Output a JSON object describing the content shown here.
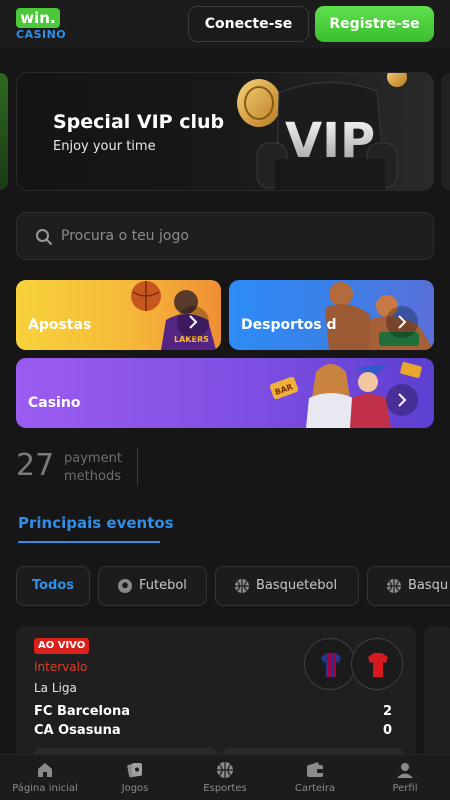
{
  "header": {
    "logo_top": "win.",
    "logo_bottom": "CASINO",
    "login_label": "Conecte-se",
    "register_label": "Registre-se"
  },
  "banner": {
    "title": "Special VIP club",
    "subtitle": "Enjoy your time",
    "art_text": "VIP"
  },
  "search": {
    "placeholder": "Procura o teu jogo"
  },
  "categories": [
    {
      "label": "Apostas"
    },
    {
      "label": "Desportos d"
    },
    {
      "label": "Casino"
    }
  ],
  "payment": {
    "count": "27",
    "label": "payment methods"
  },
  "section": {
    "title": "Principais eventos"
  },
  "chips": [
    {
      "label": "Todos",
      "icon": "none",
      "active": true
    },
    {
      "label": "Futebol",
      "icon": "soccer-ball-icon"
    },
    {
      "label": "Basquetebol",
      "icon": "basketball-icon"
    },
    {
      "label": "Basqu",
      "icon": "basketball-icon"
    }
  ],
  "event": {
    "live_label": "AO VIVO",
    "status": "Intervalo",
    "league": "La Liga",
    "teams": [
      {
        "name": "FC Barcelona",
        "score": "2"
      },
      {
        "name": "CA Osasuna",
        "score": "0"
      }
    ]
  },
  "bottom_nav": [
    {
      "label": "Página inicial",
      "icon": "home-icon"
    },
    {
      "label": "Jogos",
      "icon": "cards-icon"
    },
    {
      "label": "Esportes",
      "icon": "basketball-icon"
    },
    {
      "label": "Carteira",
      "icon": "wallet-icon"
    },
    {
      "label": "Perfil",
      "icon": "user-icon"
    }
  ],
  "colors": {
    "background": "#161616",
    "accent_blue": "#2f8fe8",
    "register_green": "#4cc93b",
    "live_red": "#d9201b"
  }
}
